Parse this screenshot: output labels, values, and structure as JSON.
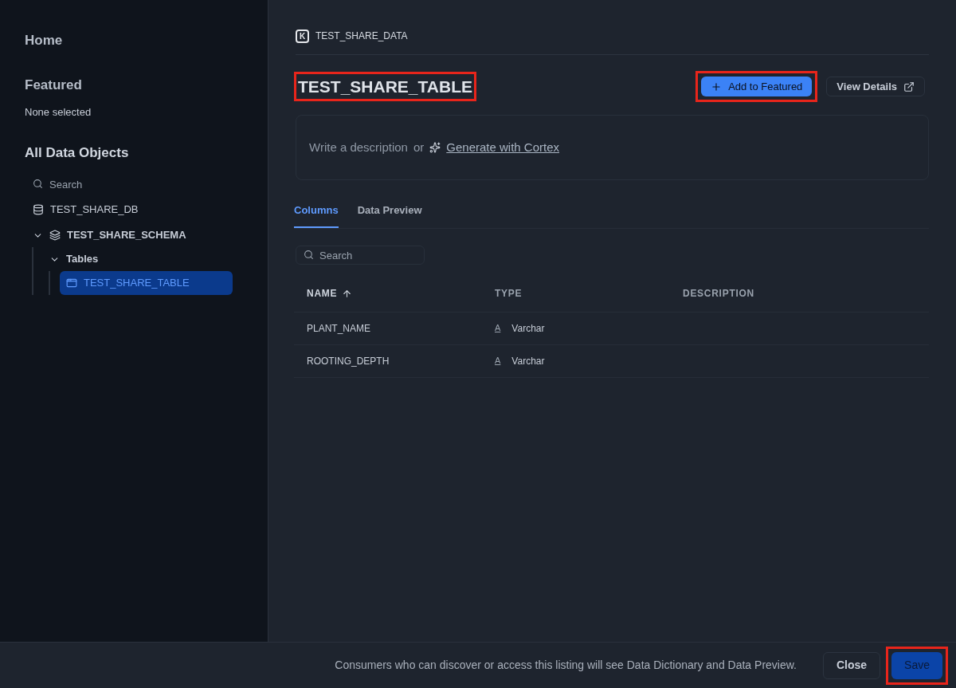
{
  "sidebar": {
    "home": "Home",
    "featured": {
      "title": "Featured",
      "value": "None selected"
    },
    "objects": {
      "title": "All Data Objects",
      "search": {
        "placeholder": "Search"
      },
      "tree": [
        {
          "label": "TEST_SHARE_DB",
          "kind": "database"
        },
        {
          "label": "TEST_SHARE_SCHEMA",
          "kind": "schema",
          "expanded": true,
          "selected": false,
          "children": [
            {
              "label": "Tables",
              "kind": "folder",
              "expanded": true,
              "selected": false,
              "children": [
                {
                  "label": "TEST_SHARE_TABLE",
                  "kind": "table",
                  "selected": true
                }
              ]
            }
          ]
        }
      ]
    }
  },
  "main": {
    "breadcrumb": {
      "badge": "K",
      "label": "TEST_SHARE_DATA"
    },
    "title": "TEST_SHARE_TABLE",
    "title_highlighted": true,
    "buttons": [
      {
        "label": "Add to Featured",
        "kind": "primary",
        "highlighted": true
      },
      {
        "label": "View Details",
        "kind": "secondary",
        "highlighted": false
      }
    ],
    "description": {
      "prompt": "Write a description",
      "or": "or",
      "link": "Generate with Cortex"
    },
    "tabs": [
      {
        "label": "Columns",
        "selected": true
      },
      {
        "label": "Data Preview",
        "selected": false
      }
    ],
    "search": {
      "placeholder": "Search"
    },
    "table": {
      "columns": [
        "NAME",
        "TYPE",
        "DESCRIPTION"
      ],
      "rows": [
        {
          "name": "PLANT_NAME",
          "type_icon": "A",
          "type": "Varchar"
        },
        {
          "name": "ROOTING_DEPTH",
          "type_icon": "A",
          "type": "Varchar"
        }
      ]
    }
  },
  "footer": {
    "note": "Consumers who can discover or access this listing will see Data Dictionary and Data Preview.",
    "buttons": [
      {
        "label": "Close",
        "kind": "secondary",
        "highlighted": false
      },
      {
        "label": "Save",
        "kind": "primary",
        "highlighted": true
      }
    ]
  }
}
